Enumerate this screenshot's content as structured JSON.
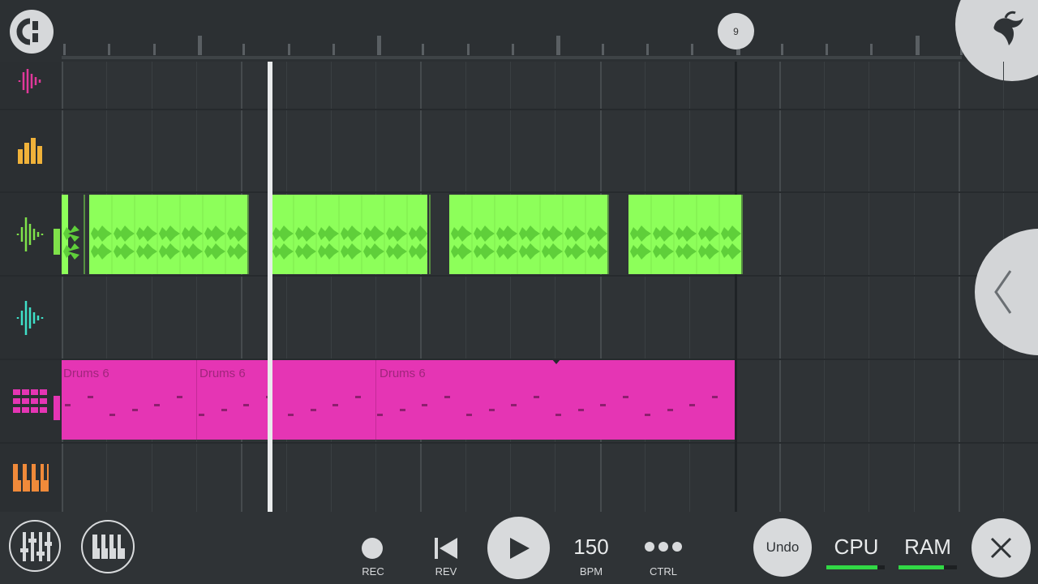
{
  "timeline": {
    "bar_marker": "9"
  },
  "tracks": [
    {
      "name": "audio-track-1",
      "icon": "waveform-icon",
      "color": "#e0389a"
    },
    {
      "name": "automation-track",
      "icon": "bars-icon",
      "color": "#f0b23a"
    },
    {
      "name": "audio-track-2",
      "icon": "waveform-icon",
      "color": "#7fe24a"
    },
    {
      "name": "audio-track-3",
      "icon": "waveform-icon",
      "color": "#3fe0c8"
    },
    {
      "name": "pattern-track",
      "icon": "step-sequencer-icon",
      "color": "#e535b4"
    },
    {
      "name": "piano-roll-track",
      "icon": "piano-icon",
      "color": "#f08a3a"
    }
  ],
  "clips": {
    "pattern_label": "Drums 6",
    "pattern_labels": [
      "Drums 6",
      "Drums 6",
      "Drums 6"
    ],
    "audio_color": "#8dff5a",
    "pattern_color": "#e535b4"
  },
  "transport": {
    "rec_label": "REC",
    "rev_label": "REV",
    "bpm_value": "150",
    "bpm_label": "BPM",
    "ctrl_label": "CTRL",
    "undo_label": "Undo",
    "cpu_label": "CPU",
    "cpu_level": 0.88,
    "ram_label": "RAM",
    "ram_level": 0.78
  },
  "icons": [
    "snap-icon",
    "fl-fruit-logo-icon",
    "mixer-icon",
    "piano-keys-icon",
    "record-icon",
    "rewind-icon",
    "play-icon",
    "more-dots-icon",
    "close-icon",
    "chevron-left-icon"
  ]
}
